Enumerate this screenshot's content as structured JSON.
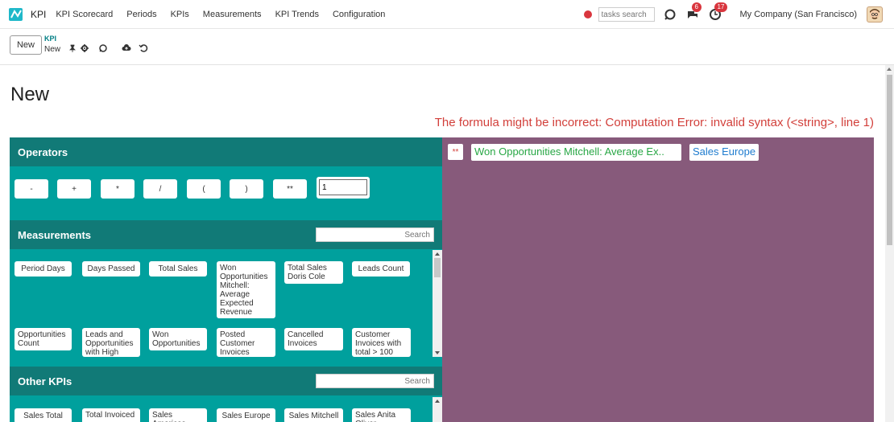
{
  "navbar": {
    "app_name": "KPI",
    "menu": [
      "KPI Scorecard",
      "Periods",
      "KPIs",
      "Measurements",
      "KPI Trends",
      "Configuration"
    ],
    "tasks_search_placeholder": "tasks search",
    "messages_count": "6",
    "activities_count": "17",
    "company": "My Company (San Francisco)"
  },
  "control_panel": {
    "new_label": "New",
    "breadcrumb_parent": "KPI",
    "breadcrumb_current": "New"
  },
  "form": {
    "title": "New",
    "error": "The formula might be incorrect: Computation Error: invalid syntax (<string>, line 1)"
  },
  "operators": {
    "header": "Operators",
    "buttons": [
      "-",
      "+",
      "*",
      "/",
      "(",
      ")",
      "**"
    ],
    "number_value": "1"
  },
  "measurements": {
    "header": "Measurements",
    "search_placeholder": "Search",
    "items": [
      "Period Days",
      "Days Passed",
      "Total Sales",
      "Won Opportunities Mitchell: Average Expected Revenue",
      "Total Sales Doris Cole",
      "Leads Count",
      "Opportunities Count",
      "Leads and Opportunities with High Priority",
      "Won Opportunities",
      "Posted Customer Invoices",
      "Cancelled Invoices",
      "Customer Invoices with total > 100"
    ]
  },
  "other_kpis": {
    "header": "Other KPIs",
    "search_placeholder": "Search",
    "items": [
      "Sales Total",
      "Total Invoiced",
      "Sales Americas",
      "Sales Europe",
      "Sales Mitchell",
      "Sales Anita Oliver"
    ]
  },
  "formula": {
    "operator": "**",
    "measurement": "Won Opportunities Mitchell: Average Ex..",
    "kpi": "Sales Europe"
  },
  "colors": {
    "teal": "#00a09d",
    "teal_dark": "#117a77",
    "purple": "#875a7b",
    "error_red": "#d23f3a",
    "green": "#28a745",
    "blue": "#1f7ccf"
  }
}
